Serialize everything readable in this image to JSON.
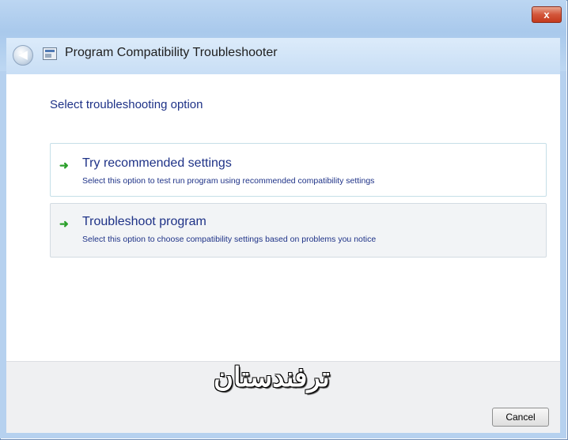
{
  "window": {
    "title": "Program Compatibility Troubleshooter",
    "close_label": "x"
  },
  "icons": {
    "back": "back-arrow-icon",
    "app": "troubleshooter-app-icon",
    "option_arrow": "green-arrow-icon"
  },
  "main": {
    "heading": "Select troubleshooting option",
    "options": [
      {
        "title": "Try recommended settings",
        "description": "Select this option to test run program using recommended compatibility settings"
      },
      {
        "title": "Troubleshoot program",
        "description": "Select this option to choose compatibility settings based on problems you notice"
      }
    ]
  },
  "footer": {
    "watermark": "ترفندستان",
    "cancel_label": "Cancel"
  },
  "colors": {
    "accent_text": "#1e3287",
    "arrow_green": "#2ca02c",
    "close_red": "#c4391d"
  }
}
